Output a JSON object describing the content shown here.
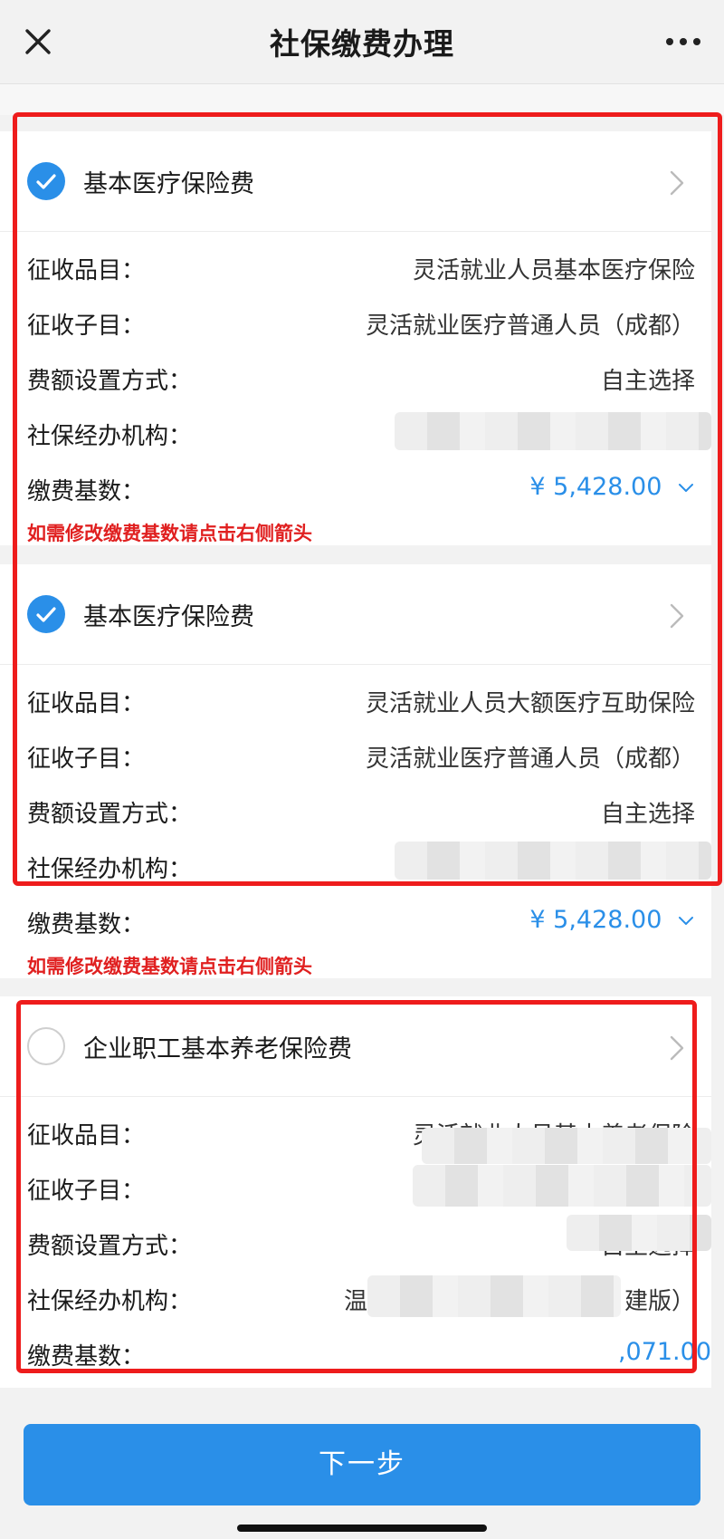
{
  "header": {
    "title": "社保缴费办理"
  },
  "cards": [
    {
      "checked": true,
      "title": "基本医疗保险费",
      "fields": [
        {
          "label": "征收品目：",
          "value": "灵活就业人员基本医疗保险"
        },
        {
          "label": "征收子目：",
          "value": "灵活就业医疗普通人员（成都）"
        },
        {
          "label": "费额设置方式：",
          "value": "自主选择"
        },
        {
          "label": "社保经办机构：",
          "value": ""
        },
        {
          "label": "缴费基数：",
          "value": "¥ 5,428.00"
        }
      ],
      "hint": "如需修改缴费基数请点击右侧箭头"
    },
    {
      "checked": true,
      "title": "基本医疗保险费",
      "fields": [
        {
          "label": "征收品目：",
          "value": "灵活就业人员大额医疗互助保险"
        },
        {
          "label": "征收子目：",
          "value": "灵活就业医疗普通人员（成都）"
        },
        {
          "label": "费额设置方式：",
          "value": "自主选择"
        },
        {
          "label": "社保经办机构：",
          "value": ""
        },
        {
          "label": "缴费基数：",
          "value": "¥ 5,428.00"
        }
      ],
      "hint": "如需修改缴费基数请点击右侧箭头"
    },
    {
      "checked": false,
      "title": "企业职工基本养老保险费",
      "fields": [
        {
          "label": "征收品目：",
          "value": "灵活就业人员基本养老保险"
        },
        {
          "label": "征收子目：",
          "value": ""
        },
        {
          "label": "费额设置方式：",
          "value": "自主选择"
        },
        {
          "label": "社保经办机构：",
          "value_left": "温",
          "value_right": "建版）"
        },
        {
          "label": "缴费基数：",
          "value": ",071.00"
        }
      ]
    }
  ],
  "footer": {
    "next_label": "下一步"
  },
  "colors": {
    "accent": "#2a8fe8",
    "warn": "#e02020",
    "highlight": "#ee1c1c"
  }
}
